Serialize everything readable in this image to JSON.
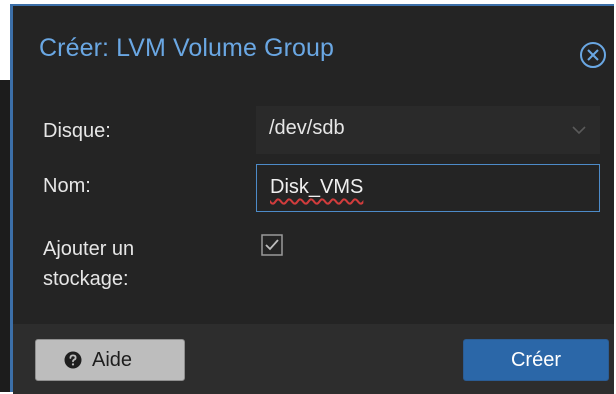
{
  "dialog": {
    "title": "Créer: LVM Volume Group"
  },
  "form": {
    "disk_label": "Disque:",
    "disk_value": "/dev/sdb",
    "name_label": "Nom:",
    "name_value": "Disk_VMS",
    "add_storage_label_line1": "Ajouter un",
    "add_storage_label_line2": "stockage:",
    "add_storage_checked": true
  },
  "footer": {
    "help_label": "Aide",
    "create_label": "Créer"
  },
  "icons": {
    "close": "close-icon",
    "chevron": "chevron-down-icon",
    "help": "question-circle-icon",
    "checkbox": "checkbox-checked-icon"
  },
  "colors": {
    "title": "#6aa7e3",
    "primary_button": "#2b67a8",
    "background": "#242424"
  }
}
